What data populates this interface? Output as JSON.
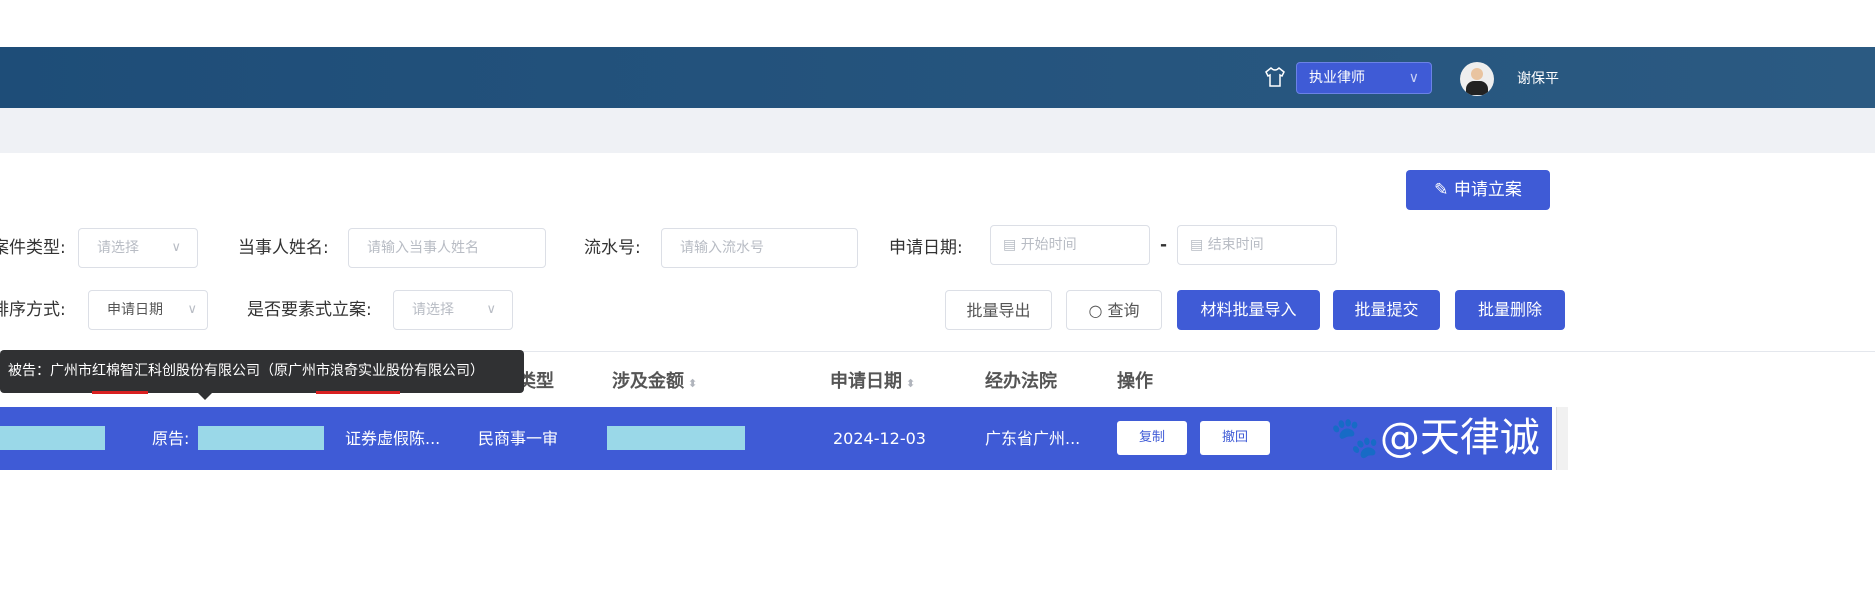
{
  "header": {
    "role_select": "执业律师",
    "user_name": "谢保平"
  },
  "apply_button": "申请立案",
  "filters": {
    "case_type_label": "案件类型:",
    "case_type_placeholder": "请选择",
    "party_label": "当事人姓名:",
    "party_placeholder": "请输入当事人姓名",
    "serial_label": "流水号:",
    "serial_placeholder": "请输入流水号",
    "date_label": "申请日期:",
    "start_placeholder": "开始时间",
    "date_sep": "-",
    "end_placeholder": "结束时间",
    "sort_label": "排序方式:",
    "sort_value": "申请日期",
    "element_label": "是否要素式立案:",
    "element_placeholder": "请选择"
  },
  "actions": {
    "export": "批量导出",
    "query": "查询",
    "import": "材料批量导入",
    "submit": "批量提交",
    "delete": "批量删除"
  },
  "table": {
    "headers": [
      "类型",
      "涉及金额",
      "申请日期",
      "经办法院",
      "操作"
    ],
    "row": {
      "plaintiff_label": "原告:",
      "cause": "证券虚假陈...",
      "type": "民商事一审",
      "date": "2024-12-03",
      "court": "广东省广州...",
      "copy": "复制",
      "withdraw": "撤回"
    }
  },
  "tooltip": {
    "prefix": "被告：广州市",
    "u1": "红棉智汇",
    "mid": "科创股份有限公司（原广州",
    "u2": "市浪奇实业股",
    "suffix": "份有限公司）"
  },
  "watermark": "@天律诚",
  "colors": {
    "primary": "#3f5bd6",
    "header": "#2b5a82"
  }
}
